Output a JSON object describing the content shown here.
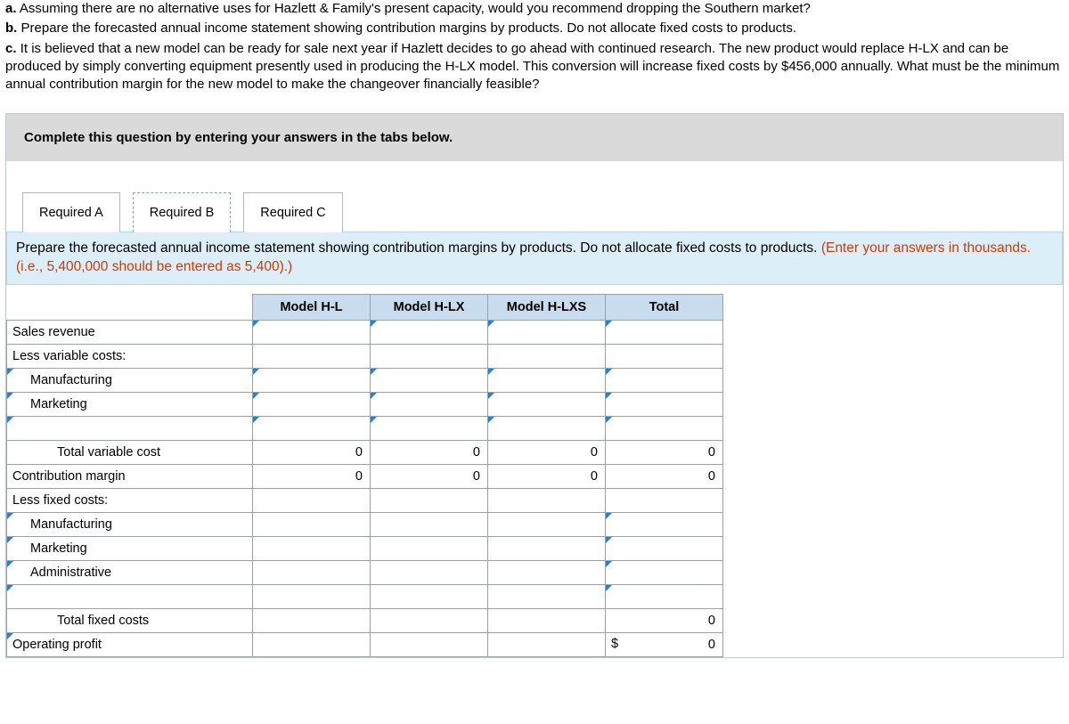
{
  "questions": {
    "a_label": "a.",
    "a_text": "Assuming there are no alternative uses for Hazlett & Family's present capacity, would you recommend dropping the Southern market?",
    "b_label": "b.",
    "b_text": "Prepare the forecasted annual income statement showing contribution margins by products. Do not allocate fixed costs to products.",
    "c_label": "c.",
    "c_text": "It is believed that a new model can be ready for sale next year if Hazlett decides to go ahead with continued research. The new product would replace H-LX and can be produced by simply converting equipment presently used in producing the H-LX model. This conversion will increase fixed costs by $456,000 annually. What must be the minimum annual contribution margin for the new model to make the changeover financially feasible?"
  },
  "gray_instruction": "Complete this question by entering your answers in the tabs below.",
  "tabs": {
    "a": "Required A",
    "b": "Required B",
    "c": "Required C"
  },
  "band": {
    "main": "Prepare the forecasted annual income statement showing contribution margins by products. Do not allocate fixed costs to products. ",
    "red": "(Enter your answers in thousands. (i.e., 5,400,000 should be entered as 5,400).)"
  },
  "table": {
    "headers": {
      "c1": "Model H-L",
      "c2": "Model H-LX",
      "c3": "Model H-LXS",
      "c4": "Total"
    },
    "rows": {
      "sales": "Sales revenue",
      "less_var": "Less variable costs:",
      "var_mfg": "Manufacturing",
      "var_mkt": "Marketing",
      "blank1": "",
      "tot_var": "Total variable cost",
      "cm": "Contribution margin",
      "less_fix": "Less fixed costs:",
      "fix_mfg": "Manufacturing",
      "fix_mkt": "Marketing",
      "fix_admin": "Administrative",
      "blank2": "",
      "tot_fix": "Total fixed costs",
      "op_profit": "Operating profit"
    },
    "values": {
      "tot_var": {
        "c1": "0",
        "c2": "0",
        "c3": "0",
        "c4": "0"
      },
      "cm": {
        "c1": "0",
        "c2": "0",
        "c3": "0",
        "c4": "0"
      },
      "tot_fix": {
        "c4": "0"
      },
      "op_profit": {
        "c4_prefix": "$",
        "c4": "0"
      }
    }
  }
}
